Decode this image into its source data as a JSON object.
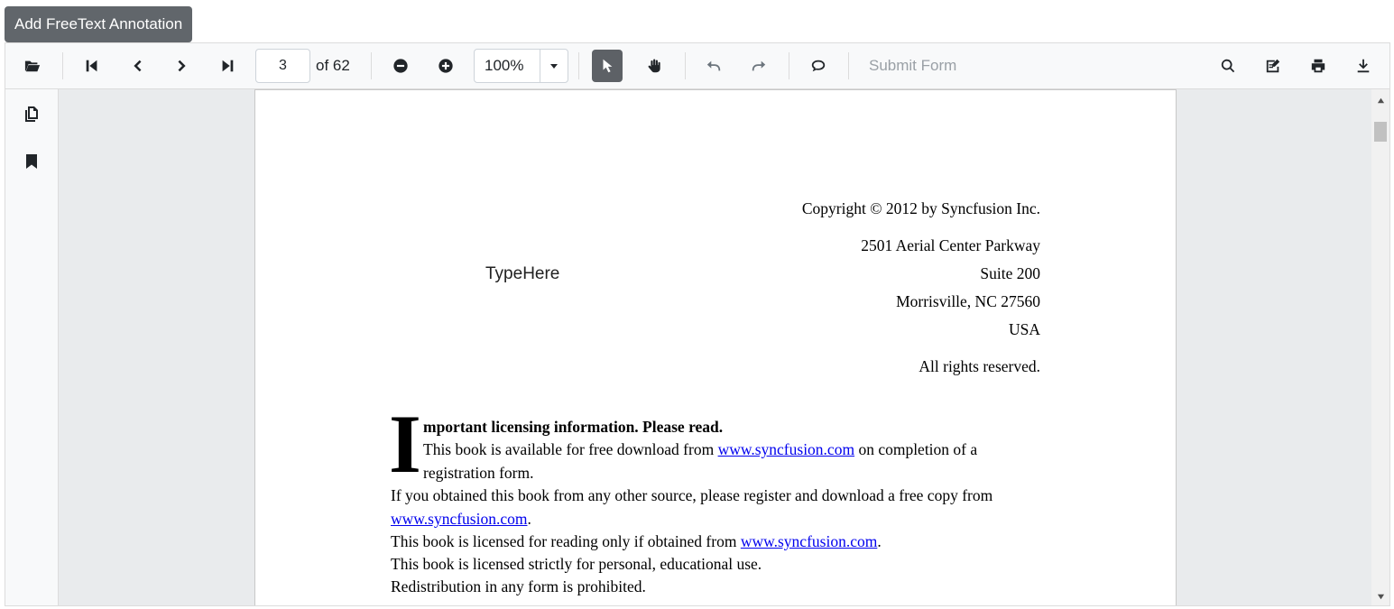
{
  "top_button": {
    "label": "Add FreeText Annotation"
  },
  "toolbar": {
    "open_icon": "folder-open-icon",
    "current_page": "3",
    "page_of": "of 62",
    "zoom_value": "100%",
    "submit_form_label": "Submit Form"
  },
  "page": {
    "copyright": "Copyright © 2012 by Syncfusion Inc.",
    "address_line1": "2501 Aerial Center Parkway",
    "address_line2": "Suite 200",
    "address_line3": "Morrisville, NC 27560",
    "address_line4": "USA",
    "rights": "All rights reserved.",
    "freetext_annotation": "TypeHere",
    "drop_cap": "I",
    "heading_rest": "mportant licensing information. Please read.",
    "line1_pre": "This book is available for free download from ",
    "line1_link": "www.syncfusion.com",
    "line1_post": " on completion of a",
    "line2": "registration form.",
    "line3": "If you obtained this book from any other source, please register and download a free copy from",
    "line4_link": "www.syncfusion.com",
    "line4_post": ".",
    "line5_pre": "This book is licensed for reading only if obtained from ",
    "line5_link": "www.syncfusion.com",
    "line5_post": ".",
    "line6": "This book is licensed strictly for personal, educational use.",
    "line7": "Redistribution in any form is prohibited."
  }
}
